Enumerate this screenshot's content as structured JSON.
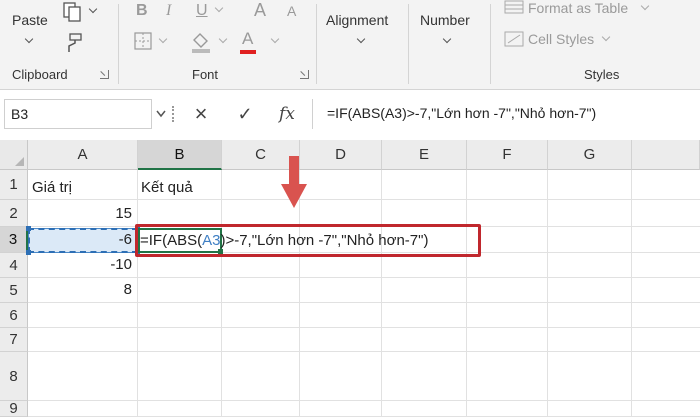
{
  "ribbon": {
    "clipboard": {
      "label": "Clipboard",
      "paste_label": "Paste",
      "paste_icon": "paste-icon",
      "copy_icon": "copy-icon",
      "format_painter_icon": "format-painter-icon"
    },
    "font": {
      "label": "Font",
      "bold_label": "B",
      "italic_label": "I",
      "underline_label": "U",
      "grow_font_label": "A",
      "shrink_font_label": "A",
      "font_color_label": "A",
      "borders_icon": "borders-icon",
      "fill_icon": "fill-color-icon",
      "font_color_underline_color": "#e02020"
    },
    "alignment": {
      "label": "Alignment"
    },
    "number": {
      "label": "Number"
    },
    "styles": {
      "label": "Styles",
      "format_as_table_label": "Format as Table",
      "cell_styles_label": "Cell Styles"
    }
  },
  "formula_bar": {
    "name_box": "B3",
    "cancel_icon": "×",
    "enter_icon": "✓",
    "fx_label": "fx",
    "formula": "=IF(ABS(A3)>-7,\"Lớn hơn -7\",\"Nhỏ hơn-7\")"
  },
  "sheet": {
    "columns": [
      "A",
      "B",
      "C",
      "D",
      "E",
      "F",
      "G"
    ],
    "rows": [
      "1",
      "2",
      "3",
      "4",
      "5",
      "6",
      "7",
      "8",
      "9"
    ],
    "active_column": "B",
    "active_row": "3",
    "cells": {
      "A1": "Giá trị",
      "B1": "Kết quả",
      "A2": "15",
      "A3": "-6",
      "A4": "-10",
      "A5": "8"
    },
    "editing": {
      "prefix": "=IF(ABS(",
      "ref": "A3",
      "suffix": ")>-7,\"Lớn hơn -7\",\"Nhỏ hơn-7\")"
    }
  },
  "colors": {
    "accent_green": "#217346",
    "highlight_red": "#c0272d",
    "arrow_red": "#d9534f",
    "reference_blue": "#3f7fc4"
  }
}
